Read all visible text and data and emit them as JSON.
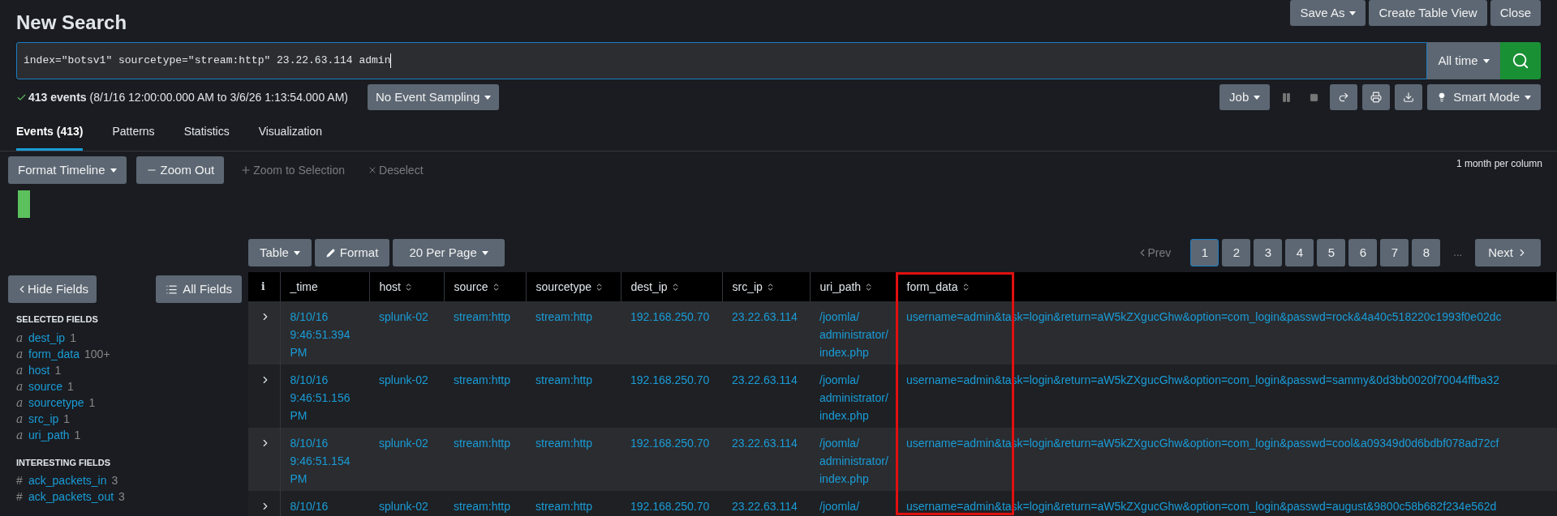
{
  "title": "New Search",
  "header_buttons": [
    {
      "label": "Save As",
      "dropdown": true
    },
    {
      "label": "Create Table View",
      "dropdown": false
    },
    {
      "label": "Close",
      "dropdown": false
    }
  ],
  "search": {
    "value": "index=\"botsv1\" sourcetype=\"stream:http\" 23.22.63.114 admin",
    "time_range": "All time"
  },
  "status": {
    "count": "413 events",
    "range": "(8/1/16 12:00:00.000 AM to 3/6/26 1:13:54.000 AM)",
    "sampling": "No Event Sampling"
  },
  "job": {
    "label": "Job",
    "mode": "Smart Mode"
  },
  "tabs": [
    {
      "label": "Events (413)",
      "selected": true
    },
    {
      "label": "Patterns",
      "selected": false
    },
    {
      "label": "Statistics",
      "selected": false
    },
    {
      "label": "Visualization",
      "selected": false
    }
  ],
  "timeline": {
    "format": "Format Timeline",
    "zoom_out": "Zoom Out",
    "zoom_selection": "Zoom to Selection",
    "deselect": "Deselect",
    "scale": "1 month per column"
  },
  "results_toolbar": {
    "table": "Table",
    "format": "Format",
    "per_page": "20 Per Page"
  },
  "pagination": {
    "prev": "Prev",
    "next": "Next",
    "ellipsis": "...",
    "pages": [
      {
        "label": "1",
        "selected": true
      },
      {
        "label": "2",
        "selected": false
      },
      {
        "label": "3",
        "selected": false
      },
      {
        "label": "4",
        "selected": false
      },
      {
        "label": "5",
        "selected": false
      },
      {
        "label": "6",
        "selected": false
      },
      {
        "label": "7",
        "selected": false
      },
      {
        "label": "8",
        "selected": false
      }
    ]
  },
  "sidebar": {
    "hide": "Hide Fields",
    "all": "All Fields",
    "selected_title": "SELECTED FIELDS",
    "selected_fields": [
      {
        "type": "a",
        "name": "dest_ip",
        "count": "1"
      },
      {
        "type": "a",
        "name": "form_data",
        "count": "100+"
      },
      {
        "type": "a",
        "name": "host",
        "count": "1"
      },
      {
        "type": "a",
        "name": "source",
        "count": "1"
      },
      {
        "type": "a",
        "name": "sourcetype",
        "count": "1"
      },
      {
        "type": "a",
        "name": "src_ip",
        "count": "1"
      },
      {
        "type": "a",
        "name": "uri_path",
        "count": "1"
      }
    ],
    "interesting_title": "INTERESTING FIELDS",
    "interesting_fields": [
      {
        "type": "#",
        "name": "ack_packets_in",
        "count": "3"
      },
      {
        "type": "#",
        "name": "ack_packets_out",
        "count": "3"
      }
    ]
  },
  "table": {
    "info": "i",
    "columns": [
      {
        "label": "_time",
        "highlighted": false
      },
      {
        "label": "host",
        "highlighted": false
      },
      {
        "label": "source",
        "highlighted": false
      },
      {
        "label": "sourcetype",
        "highlighted": false
      },
      {
        "label": "dest_ip",
        "highlighted": false
      },
      {
        "label": "src_ip",
        "highlighted": false
      },
      {
        "label": "uri_path",
        "highlighted": false
      },
      {
        "label": "form_data",
        "highlighted": true
      }
    ],
    "rows": [
      {
        "cells": [
          "8/10/16 9:46:51.394 PM",
          "splunk-02",
          "stream:http",
          "stream:http",
          "192.168.250.70",
          "23.22.63.114",
          "/joomla/ administrator/ index.php",
          "username=admin&task=login&return=aW5kZXgucGhw&option=com_login&passwd=rock&4a40c518220c1993f0e02dc"
        ]
      },
      {
        "cells": [
          "8/10/16 9:46:51.156 PM",
          "splunk-02",
          "stream:http",
          "stream:http",
          "192.168.250.70",
          "23.22.63.114",
          "/joomla/ administrator/ index.php",
          "username=admin&task=login&return=aW5kZXgucGhw&option=com_login&passwd=sammy&0d3bb0020f70044ffba32"
        ]
      },
      {
        "cells": [
          "8/10/16 9:46:51.154 PM",
          "splunk-02",
          "stream:http",
          "stream:http",
          "192.168.250.70",
          "23.22.63.114",
          "/joomla/ administrator/ index.php",
          "username=admin&task=login&return=aW5kZXgucGhw&option=com_login&passwd=cool&a09349d0d6bdbf078ad72cf"
        ]
      },
      {
        "cells": [
          "8/10/16",
          "splunk-02",
          "stream:http",
          "stream:http",
          "192.168.250.70",
          "23.22.63.114",
          "/joomla/",
          "username=admin&task=login&return=aW5kZXgucGhw&option=com_login&passwd=august&9800c58b682f234e562d"
        ]
      }
    ]
  }
}
